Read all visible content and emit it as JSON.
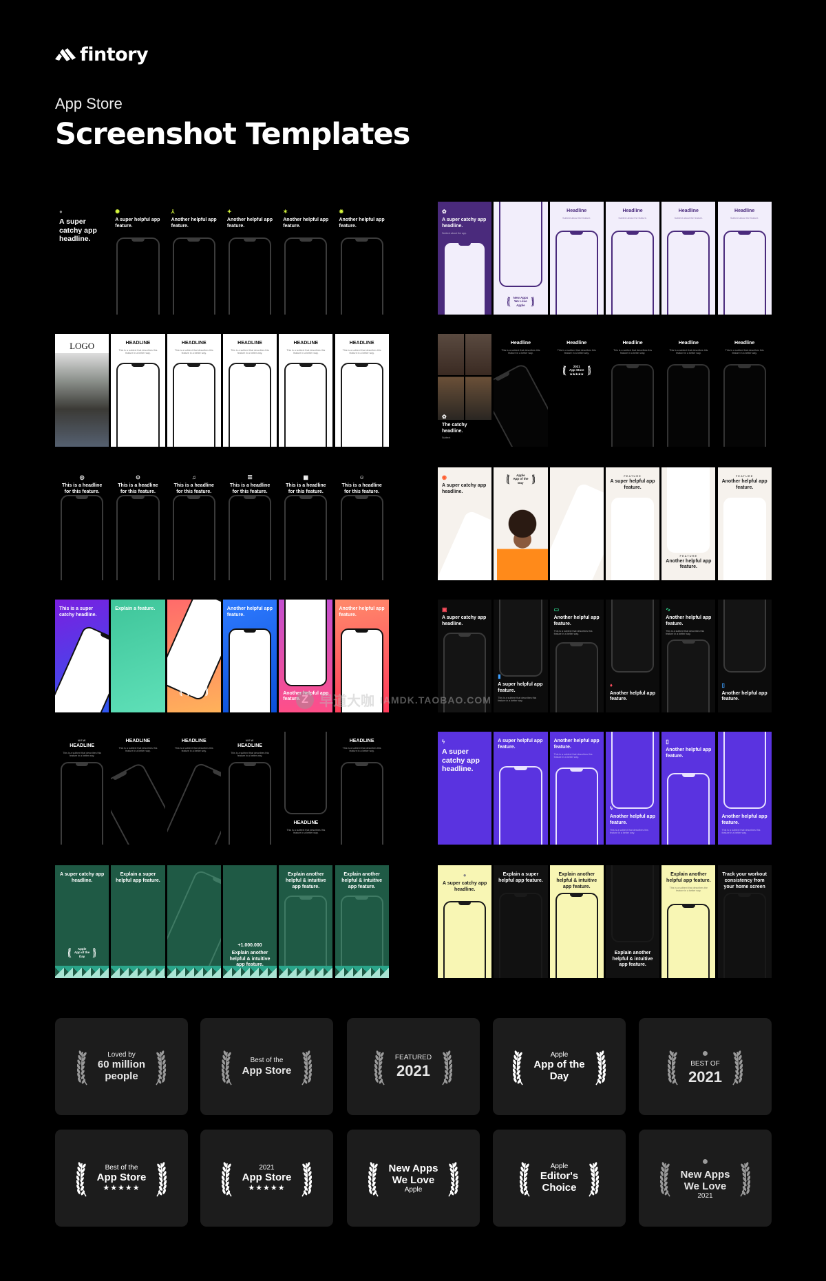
{
  "brand": {
    "name": "fintory"
  },
  "header": {
    "kicker": "App Store",
    "title": "Screenshot Templates"
  },
  "watermark": {
    "mark": "Z",
    "text": "早道大咖",
    "url": "IAMDK.TAOBAO.COM"
  },
  "colors": {
    "page_bg": "#000000",
    "badge_bg": "#1c1c1c",
    "accent_lime": "#d4f53c"
  },
  "templates": [
    {
      "colors": {
        "bg": [
          "#000000"
        ],
        "fg": "#ffffff",
        "frame": "#3c3c3c",
        "fill": "transparent"
      },
      "panels": [
        {
          "icon": "dot-icon",
          "headline": "A super catchy app headline."
        },
        {
          "icon": "sun-icon",
          "headline": "A super helpful app feature."
        },
        {
          "icon": "tri-star-icon",
          "headline": "Another helpful app feature."
        },
        {
          "icon": "sparkle-icon",
          "headline": "Another helpful app feature."
        },
        {
          "icon": "star-icon",
          "headline": "Another helpful app feature."
        },
        {
          "icon": "burst-icon",
          "headline": "Another helpful app feature."
        }
      ]
    },
    {
      "colors": {
        "bg": [
          "#4a2a7c",
          "#f2eefb"
        ],
        "fg": "#4a2a7c",
        "frame": "#4a2a7c",
        "fill": "#f2eefb"
      },
      "panels": [
        {
          "icon": "flower-icon",
          "headline": "A super catchy app headline.",
          "sub": "Subtext about the app."
        },
        {
          "badge": [
            "New Apps",
            "We Love",
            "Apple"
          ]
        },
        {
          "headline": "Headline",
          "sub": "Subtext about the feature."
        },
        {
          "headline": "Headline",
          "sub": "Subtext about the feature."
        },
        {
          "headline": "Headline",
          "sub": "Subtext about the feature."
        },
        {
          "headline": "Headline",
          "sub": "Subtext about the feature."
        }
      ]
    },
    {
      "colors": {
        "bg": [
          "#ffffff"
        ],
        "fg": "#111111",
        "frame": "#1a1a1a",
        "fill": "#ffffff"
      },
      "panels": [
        {
          "headline": "LOGO"
        },
        {
          "headline": "HEADLINE",
          "sub": "This is a subtext that describes this feature in a better way."
        },
        {
          "headline": "HEADLINE",
          "sub": "This is a subtext that describes this feature in a better way."
        },
        {
          "headline": "HEADLINE",
          "sub": "This is a subtext that describes this feature in a better way."
        },
        {
          "headline": "HEADLINE",
          "sub": "This is a subtext that describes this feature in a better way."
        },
        {
          "headline": "HEADLINE",
          "sub": "This is a subtext that describes this feature in a better way."
        }
      ]
    },
    {
      "colors": {
        "bg": [
          "#000000"
        ],
        "fg": "#ffffff",
        "frame": "#333333",
        "fill": "#050505"
      },
      "panels": [
        {
          "icon": "flower-icon",
          "headline": "The catchy headline.",
          "sub": "Subtext"
        },
        {
          "headline": "Headline",
          "sub": "This is a subtext that describes this feature in a better way."
        },
        {
          "headline": "Headline",
          "sub": "This is a subtext that describes this feature in a better way.",
          "badge": [
            "2021",
            "App Store",
            "★★★★★"
          ]
        },
        {
          "headline": "Headline",
          "sub": "This is a subtext that describes this feature in a better way."
        },
        {
          "headline": "Headline",
          "sub": "This is a subtext that describes this feature in a better way."
        },
        {
          "headline": "Headline",
          "sub": "This is a subtext that describes this feature in a better way."
        }
      ]
    },
    {
      "colors": {
        "bg": [
          "#000000"
        ],
        "fg": "#ffffff",
        "frame": "#3a3a3a",
        "fill": "transparent"
      },
      "panels": [
        {
          "icon": "target-icon",
          "headline": "This is a headline for this feature."
        },
        {
          "icon": "record-icon",
          "headline": "This is a headline for this feature."
        },
        {
          "icon": "bell-icon",
          "headline": "This is a headline for this feature."
        },
        {
          "icon": "list-icon",
          "headline": "This is a headline for this feature."
        },
        {
          "icon": "calendar-icon",
          "headline": "This is a headline for this feature."
        },
        {
          "icon": "users-icon",
          "headline": "This is a headline for this feature."
        }
      ]
    },
    {
      "colors": {
        "bg": [
          "#f6f2ed"
        ],
        "fg": "#1a1a1a",
        "frame": "#ffffff",
        "fill": "#ffffff"
      },
      "panels": [
        {
          "icon": "app-icon",
          "headline": "A super catchy app headline."
        },
        {
          "badge": [
            "Apple",
            "App of the",
            "Day"
          ]
        },
        {},
        {
          "eyebrow": "FEATURE",
          "headline": "A super helpful app feature."
        },
        {
          "eyebrow": "FEATURE",
          "headline": "Another helpful app feature."
        },
        {
          "eyebrow": "FEATURE",
          "headline": "Another helpful app feature."
        }
      ]
    },
    {
      "colors": {
        "bg": [
          "linear-gradient(160deg,#7a1fe0,#2f57f0)",
          "linear-gradient(160deg,#3fc59a,#5fe0b8)",
          "linear-gradient(170deg,#ff6b6b,#ffb25a)",
          "linear-gradient(160deg,#2f7bff,#0a4fd8)",
          "linear-gradient(180deg,#c34fd0,#ff4f88)",
          "linear-gradient(170deg,#ff8a6b,#ff3a5a)"
        ],
        "fg": "#ffffff",
        "frame": "#111111",
        "fill": "#ffffff"
      },
      "panels": [
        {
          "headline": "This is a super catchy headline."
        },
        {
          "headline": "Explain a feature."
        },
        {
          "badge": [
            "Best of the",
            "App Store",
            "★★★★★"
          ]
        },
        {
          "headline": "Another helpful app feature."
        },
        {
          "headline": "Another helpful app feature."
        },
        {
          "headline": "Another helpful app feature."
        }
      ]
    },
    {
      "colors": {
        "bg": [
          "#0c0c0c"
        ],
        "fg": "#ffffff",
        "frame": "#3a3a3a",
        "fill": "#141414"
      },
      "panels": [
        {
          "icon": "pulse-icon",
          "headline": "A super catchy app headline."
        },
        {
          "icon": "chart-icon",
          "headline": "A super helpful app feature.",
          "sub": "This is a subtext that describes this feature in a better way."
        },
        {
          "icon": "chat-icon",
          "headline": "Another helpful app feature.",
          "sub": "This is a subtext that describes this feature in a better way."
        },
        {
          "icon": "drop-icon",
          "headline": "Another helpful app feature."
        },
        {
          "icon": "heartbeat-icon",
          "headline": "Another helpful app feature.",
          "sub": "This is a subtext that describes this feature in a better way."
        },
        {
          "icon": "battery-icon",
          "headline": "Another helpful app feature."
        }
      ]
    },
    {
      "colors": {
        "bg": [
          "#000000"
        ],
        "fg": "#ffffff",
        "frame": "#3c3c3c",
        "fill": "transparent"
      },
      "panels": [
        {
          "eyebrow": "NEW",
          "headline": "HEADLINE",
          "sub": "This is a subtext that describes this feature in a better way."
        },
        {
          "headline": "HEADLINE",
          "sub": "This is a subtext that describes this feature in a better way."
        },
        {
          "headline": "HEADLINE",
          "sub": "This is a subtext that describes this feature in a better way."
        },
        {
          "eyebrow": "NEW",
          "headline": "HEADLINE",
          "sub": "This is a subtext that describes this feature in a better way."
        },
        {
          "headline": "HEADLINE",
          "sub": "This is a subtext that describes this feature in a better way."
        },
        {
          "headline": "HEADLINE",
          "sub": "This is a subtext that describes this feature in a better way."
        }
      ]
    },
    {
      "colors": {
        "bg": [
          "#5a33e0"
        ],
        "fg": "#ffffff",
        "frame": "#e8e2ff",
        "fill": "#5a33e0"
      },
      "panels": [
        {
          "icon": "bolt-icon",
          "headline": "A super catchy app headline."
        },
        {
          "headline": "A super helpful app feature."
        },
        {
          "headline": "Another helpful app feature.",
          "sub": "This is a subtext that describes this feature in a better way."
        },
        {
          "icon": "bolt-icon",
          "headline": "Another helpful app feature.",
          "sub": "This is a subtext that describes this feature in a better way."
        },
        {
          "icon": "phone-icon",
          "headline": "Another helpful app feature."
        },
        {
          "headline": "Another helpful app feature.",
          "sub": "This is a subtext that describes this feature in a better way."
        }
      ]
    },
    {
      "colors": {
        "bg": [
          "#1f5a45"
        ],
        "fg": "#ffffff",
        "frame": "#3f7a64",
        "fill": "transparent"
      },
      "panels": [
        {
          "headline": "A super catchy app headline.",
          "badge": [
            "Apple",
            "App of the",
            "Day"
          ]
        },
        {
          "headline": "Explain a super helpful app feature."
        },
        {},
        {
          "eyebrow": "+1.000.000",
          "headline": "Explain another helpful & intuitive app feature."
        },
        {
          "headline": "Explain another helpful & intuitive app feature."
        },
        {
          "headline": "Explain another helpful & intuitive app feature."
        }
      ]
    },
    {
      "colors": {
        "bg": [
          "#f8f6b4",
          "#111111"
        ],
        "fg": "#1a1a1a",
        "frame": "#1a1a1a",
        "fill": "#f8f6b4"
      },
      "panels": [
        {
          "icon": "dot-icon",
          "headline": "A super catchy app headline."
        },
        {
          "headline": "Explain a super helpful app feature."
        },
        {
          "headline": "Explain another helpful & intuitive app feature."
        },
        {
          "headline": "Explain another helpful & intuitive app feature."
        },
        {
          "headline": "Explain another helpful app feature.",
          "sub": "This is a subtext that describes the feature in a better way."
        },
        {
          "headline": "Track your workout consistency from your home screen"
        }
      ]
    }
  ],
  "badges": [
    {
      "lines": [
        "Loved by",
        "60 million",
        "people"
      ],
      "tone": "grey"
    },
    {
      "lines": [
        "Best of the",
        "App Store"
      ],
      "tone": "grey"
    },
    {
      "lines": [
        "FEATURED",
        "2021"
      ],
      "tone": "grey"
    },
    {
      "lines": [
        "Apple",
        "App of the",
        "Day"
      ],
      "tone": "white"
    },
    {
      "apple_logo": true,
      "lines": [
        "BEST OF",
        "2021"
      ],
      "tone": "grey"
    },
    {
      "lines": [
        "Best of the",
        "App Store",
        "★★★★★"
      ],
      "tone": "white"
    },
    {
      "lines": [
        "2021",
        "App Store",
        "★★★★★"
      ],
      "tone": "white"
    },
    {
      "lines": [
        "New Apps",
        "We Love",
        "Apple"
      ],
      "tone": "white"
    },
    {
      "lines": [
        "Apple",
        "Editor's",
        "Choice"
      ],
      "tone": "white"
    },
    {
      "apple_logo": true,
      "lines": [
        "New Apps",
        "We Love",
        "2021"
      ],
      "tone": "grey"
    }
  ]
}
